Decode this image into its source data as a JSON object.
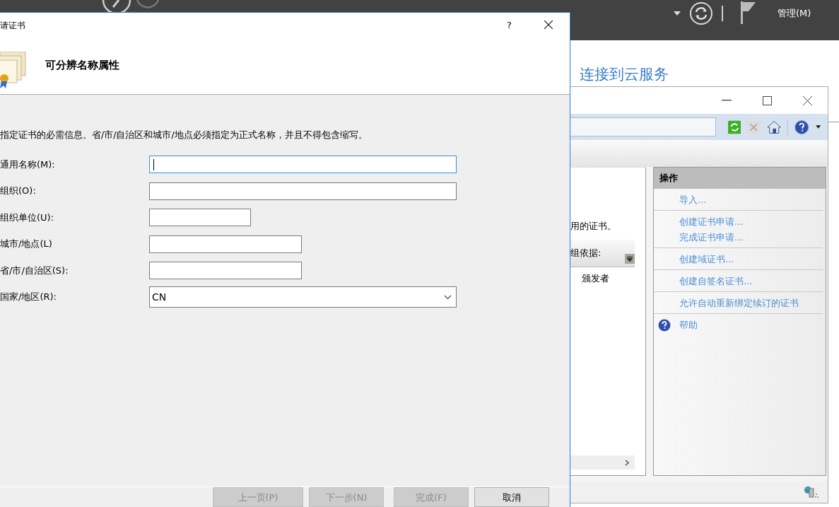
{
  "server_manager": {
    "menu": "管理(M)",
    "link": "连接到云服务"
  },
  "iis": {
    "notice": "用的证书。",
    "group_by": "组依据:",
    "column": "颁发者",
    "actions_title": "操作",
    "action_groups": [
      [
        {
          "label": "导入...",
          "kind": "link"
        }
      ],
      [
        {
          "label": "创建证书申请...",
          "kind": "link"
        },
        {
          "label": "完成证书申请...",
          "kind": "link"
        }
      ],
      [
        {
          "label": "创建域证书...",
          "kind": "link"
        }
      ],
      [
        {
          "label": "创建自签名证书...",
          "kind": "link"
        }
      ],
      [
        {
          "label": "允许自动重新绑定续订的证书",
          "kind": "link"
        }
      ],
      [
        {
          "label": "帮助",
          "kind": "help"
        }
      ]
    ]
  },
  "dialog": {
    "title": "请证书",
    "help": "?",
    "heading": "可分辨名称属性",
    "description": "指定证书的必需信息。省/市/自治区和城市/地点必须指定为正式名称，并且不得包含缩写。",
    "fields": [
      {
        "label": "通用名称(M):",
        "kind": "text",
        "focused": true
      },
      {
        "label": "组织(O):",
        "kind": "text",
        "focused": false
      },
      {
        "label": "组织单位(U):",
        "kind": "text",
        "focused": false
      },
      {
        "label": "城市/地点(L)",
        "kind": "text",
        "focused": false
      },
      {
        "label": "省/市/自治区(S):",
        "kind": "text",
        "focused": false
      },
      {
        "label": "国家/地区(R):",
        "kind": "select",
        "value": "CN",
        "focused": false
      }
    ],
    "buttons": [
      {
        "label": "上一页(P)",
        "disabled": true
      },
      {
        "label": "下一步(N)",
        "disabled": true
      },
      {
        "label": "完成(F)",
        "disabled": true
      },
      {
        "label": "取消",
        "disabled": false
      }
    ]
  }
}
